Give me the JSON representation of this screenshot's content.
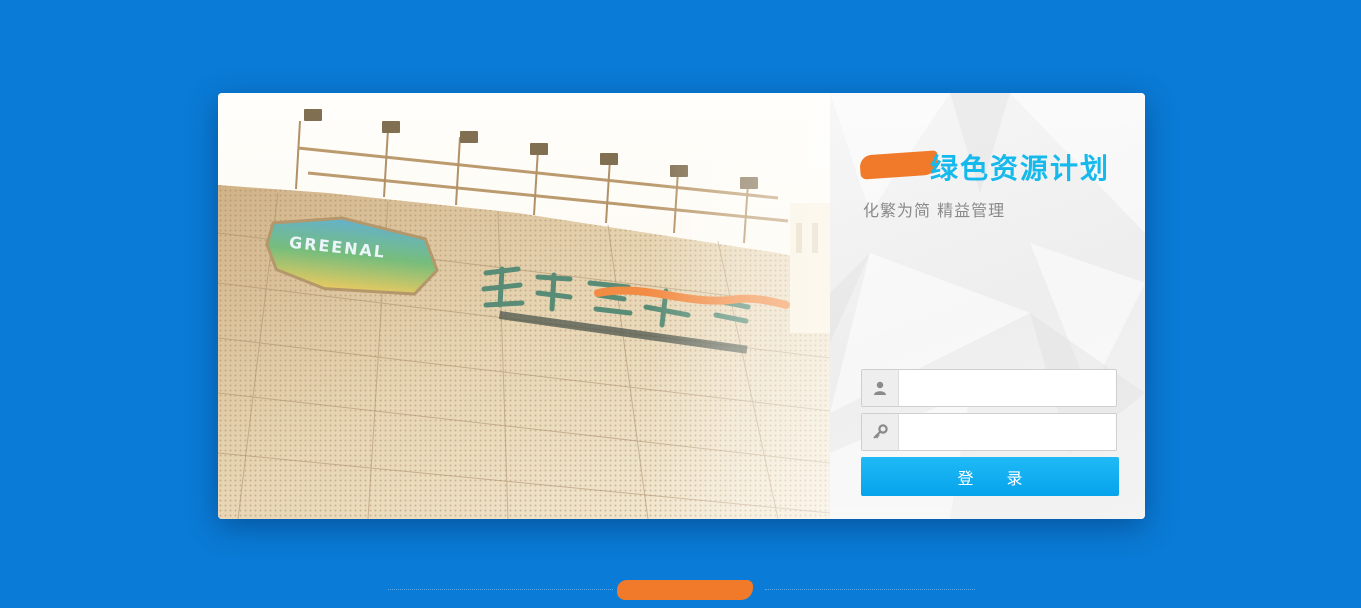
{
  "app": {
    "brand_title": "绿色资源计划",
    "slogan": "化繁为简 精益管理"
  },
  "login_form": {
    "username_icon": "user-icon",
    "password_icon": "key-icon",
    "username_value": "",
    "username_placeholder": "",
    "password_value": "",
    "password_placeholder": "",
    "submit_label": "登 录"
  },
  "banner": {
    "sign_text": "GREENAL"
  },
  "colors": {
    "page_background": "#0a7bd6",
    "brand_accent": "#15b9ec",
    "button": "#06a3ec",
    "redaction": "#f07a2a"
  }
}
